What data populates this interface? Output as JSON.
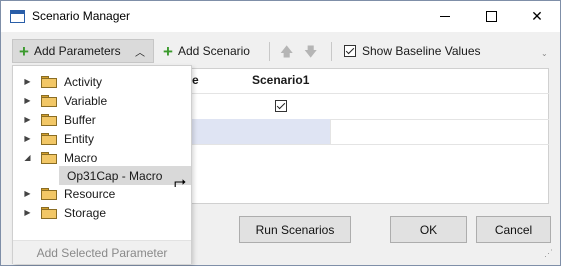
{
  "window": {
    "title": "Scenario Manager",
    "icon": "window-icon",
    "controls": {
      "minimize": "minimize-icon",
      "maximize": "maximize-icon",
      "close": "✕"
    }
  },
  "toolbar": {
    "add_parameters": "Add Parameters",
    "add_scenario": "Add Scenario",
    "move_up": "🡅",
    "move_down": "🡇",
    "show_baseline": {
      "label": "Show Baseline Values",
      "checked": true
    },
    "overflow": "⌄"
  },
  "grid": {
    "columns": [
      "e",
      "Scenario1"
    ],
    "rows": [
      {
        "scenario1_checked": true
      },
      {
        "selected": true
      }
    ]
  },
  "dropdown": {
    "items": [
      {
        "label": "Activity",
        "expander": "▶"
      },
      {
        "label": "Variable",
        "expander": "▶"
      },
      {
        "label": "Buffer",
        "expander": "▶"
      },
      {
        "label": "Entity",
        "expander": "▶"
      },
      {
        "label": "Macro",
        "expander": "◢"
      },
      {
        "label": "Op31Cap - Macro",
        "child": true
      },
      {
        "label": "Resource",
        "expander": "▶"
      },
      {
        "label": "Storage",
        "expander": "▶"
      }
    ],
    "footer": "Add Selected Parameter"
  },
  "buttons": {
    "run": "Run Scenarios",
    "ok": "OK",
    "cancel": "Cancel"
  },
  "colors": {
    "plus_green": "#3b9a2d",
    "selection": "#dfe4f3",
    "folder": "#f2c766"
  }
}
